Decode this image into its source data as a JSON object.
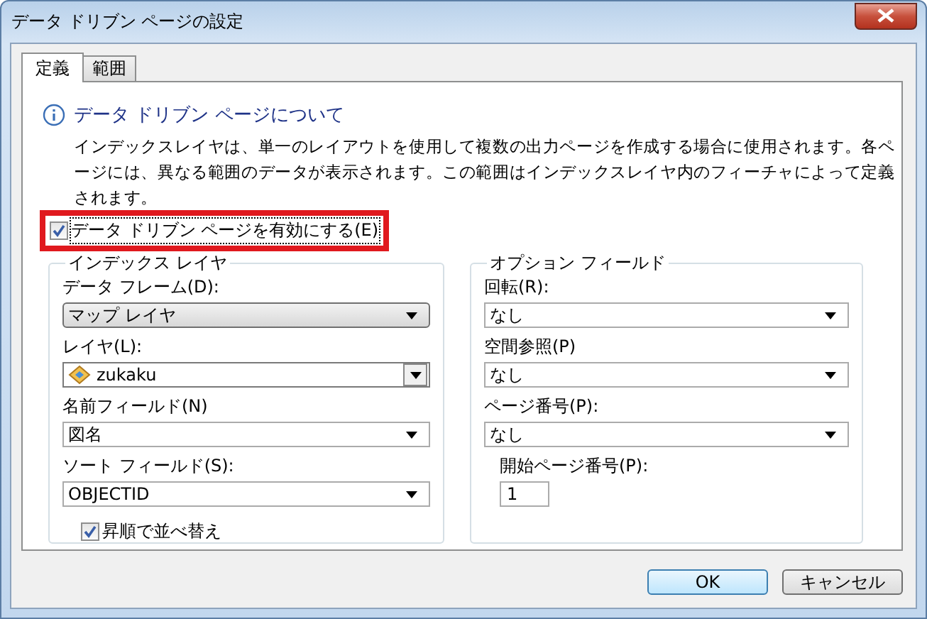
{
  "window": {
    "title": "データ ドリブン ページの設定"
  },
  "tabs": [
    {
      "label": "定義",
      "selected": true
    },
    {
      "label": "範囲",
      "selected": false
    }
  ],
  "info": {
    "heading": "データ ドリブン ページについて",
    "description": "インデックスレイヤは、単一のレイアウトを使用して複数の出力ページを作成する場合に使用されます。各ページには、異なる範囲のデータが表示されます。この範囲はインデックスレイヤ内のフィーチャによって定義されます。"
  },
  "enable_checkbox": {
    "label": "データ ドリブン ページを有効にする(E)",
    "checked": true,
    "highlighted": true
  },
  "index_layer": {
    "title": "インデックス レイヤ",
    "fields": [
      {
        "label": "データ フレーム(D):",
        "value": "マップ レイヤ",
        "kind": "dropdown"
      },
      {
        "label": "レイヤ(L):",
        "value": "zukaku",
        "kind": "layer"
      },
      {
        "label": "名前フィールド(N)",
        "value": "図名",
        "kind": "combo"
      },
      {
        "label": "ソート フィールド(S):",
        "value": "OBJECTID",
        "kind": "combo"
      }
    ],
    "sort_ascending": {
      "label": "昇順で並べ替え",
      "checked": true
    }
  },
  "optional_fields": {
    "title": "オプション フィールド",
    "fields": [
      {
        "label": "回転(R):",
        "value": "なし",
        "kind": "combo"
      },
      {
        "label": "空間参照(P)",
        "value": "なし",
        "kind": "combo"
      },
      {
        "label": "ページ番号(P):",
        "value": "なし",
        "kind": "combo"
      }
    ],
    "start_page": {
      "label": "開始ページ番号(P):",
      "value": "1"
    }
  },
  "buttons": [
    {
      "label": "OK",
      "default": true
    },
    {
      "label": "キャンセル",
      "default": false
    }
  ]
}
